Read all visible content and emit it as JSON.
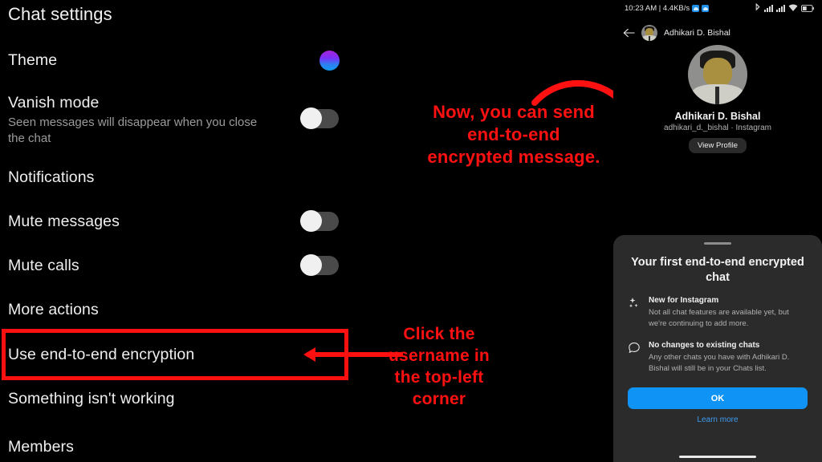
{
  "left_panel": {
    "title": "Chat settings",
    "rows": [
      {
        "label": "Theme",
        "sub": "",
        "control": "color-swatch"
      },
      {
        "label": "Vanish mode",
        "sub": "Seen messages will disappear when you close the chat",
        "control": "toggle-off"
      },
      {
        "label": "Notifications",
        "sub": "",
        "control": "none"
      },
      {
        "label": "Mute messages",
        "sub": "",
        "control": "toggle-off"
      },
      {
        "label": "Mute calls",
        "sub": "",
        "control": "toggle-off"
      },
      {
        "label": "More actions",
        "sub": "",
        "control": "none"
      },
      {
        "label": "Use end-to-end encryption",
        "sub": "",
        "control": "none"
      },
      {
        "label": "Something isn't working",
        "sub": "",
        "control": "none"
      },
      {
        "label": "Members",
        "sub": "",
        "control": "none"
      }
    ],
    "theme_color_start": "#a626d8",
    "theme_color_end": "#119bf0"
  },
  "annotations": {
    "accent_color": "#ff1111",
    "top_text": "Now, you can send end-to-end encrypted message.",
    "top_lines": [
      "Now, you can send",
      "end-to-end",
      "encrypted message."
    ],
    "bottom_text": "Click the username in the top-left corner",
    "bottom_lines": [
      "Click the",
      "username in",
      "the top-left",
      "corner"
    ]
  },
  "phone": {
    "status_bar": {
      "time": "10:23 AM | 4.4KB/s",
      "icons": [
        "app-cloud-icon",
        "app-cloud-icon",
        "bluetooth-icon",
        "signal-bars-icon",
        "signal-bars-icon",
        "wifi-icon",
        "battery-icon"
      ]
    },
    "header": {
      "back_icon": "back-arrow-icon",
      "name": "Adhikari D. Bishal"
    },
    "profile": {
      "name": "Adhikari D. Bishal",
      "handle": "adhikari_d._bishal · Instagram",
      "view_profile_label": "View Profile"
    },
    "sheet": {
      "title": "Your first end-to-end encrypted chat",
      "items": [
        {
          "icon": "sparkle-icon",
          "title": "New for Instagram",
          "desc": "Not all chat features are available yet, but we're continuing to add more."
        },
        {
          "icon": "chat-bubble-icon",
          "title": "No changes to existing chats",
          "desc": "Any other chats you have with Adhikari D. Bishal will still be in your Chats list."
        }
      ],
      "primary_button": "OK",
      "link": "Learn more",
      "primary_button_color": "#0f93f5",
      "link_color": "#3e9bf0"
    }
  }
}
